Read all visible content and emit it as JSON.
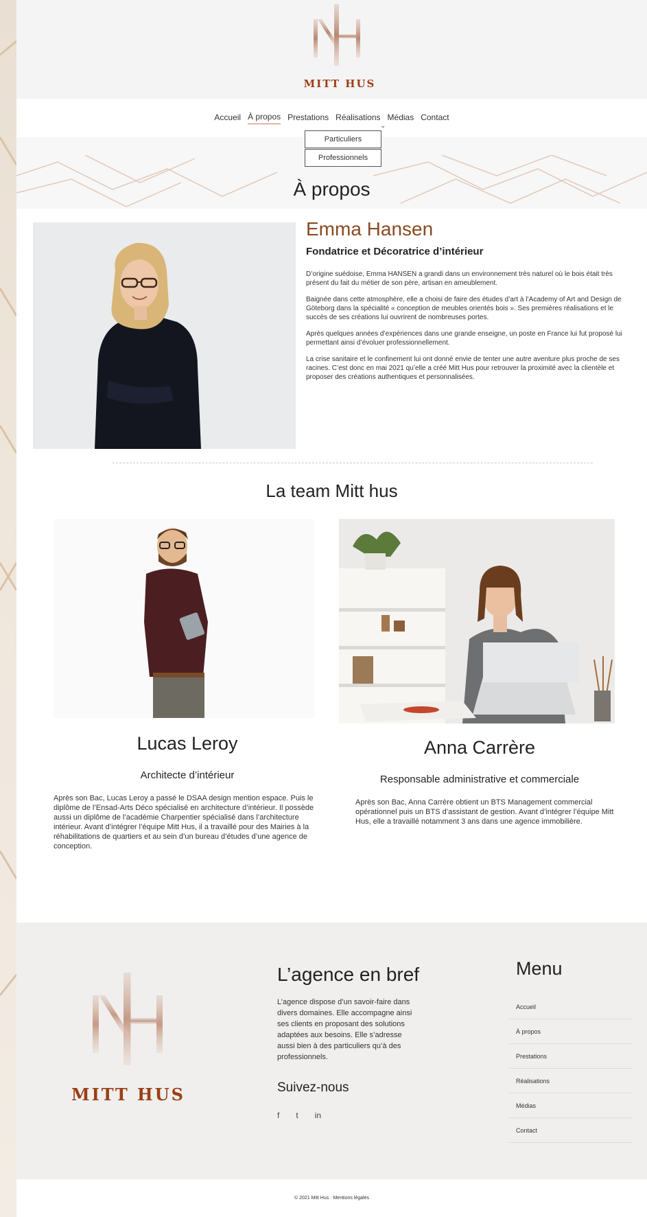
{
  "brand": {
    "name": "MITT HUS",
    "monogram": "MH",
    "accent": "#9a3f14"
  },
  "nav": {
    "items": [
      {
        "label": "Accueil"
      },
      {
        "label": "À propos",
        "active": true
      },
      {
        "label": "Prestations"
      },
      {
        "label": "Réalisations"
      },
      {
        "label": "Médias"
      },
      {
        "label": "Contact"
      }
    ],
    "dropdown": [
      "Particuliers",
      "Professionnels"
    ]
  },
  "hero": {
    "title": "À propos"
  },
  "founder": {
    "name": "Emma Hansen",
    "role": "Fondatrice et Décoratrice d’intérieur",
    "paragraphs": [
      "D’origine suédoise, Emma HANSEN a grandi dans un environnement très naturel où le bois était très présent du fait du métier de son père, artisan en ameublement.",
      "Baignée dans cette atmosphère, elle a choisi de faire des études d’art à l’Academy of Art and Design de Göteborg dans la spécialité « conception de meubles orientés bois ». Ses premières réalisations et le succès de ses créations lui ouvrirent de nombreuses portes.",
      "Après quelques années d’expériences dans une grande enseigne, un poste en France lui fut proposé lui permettant ainsi d’évoluer professionnellement.",
      "La crise sanitaire et le confinement lui ont donné envie de tenter une autre aventure plus proche de ses racines. C’est donc en mai 2021 qu’elle a créé Mitt Hus pour retrouver la proximité avec la clientèle et proposer des créations authentiques et personnalisées."
    ]
  },
  "team": {
    "title": "La team Mitt hus",
    "members": [
      {
        "name": "Lucas Leroy",
        "role": "Architecte d’intérieur",
        "bio": "Après son Bac, Lucas Leroy a passé le DSAA design mention espace. Puis le diplôme de l’Ensad-Arts Déco spécialisé en architecture d’intérieur. Il possède aussi un diplôme de l’académie Charpentier spécialisé dans l’architecture intérieur. Avant d’intégrer l’équipe Mitt Hus, il a travaillé pour des Mairies à la réhabilitations de quartiers et au sein d’un bureau d’études d’une agence de conception."
      },
      {
        "name": "Anna Carrère",
        "role": "Responsable administrative et commerciale",
        "bio": "Après son Bac, Anna Carrère obtient un BTS Management commercial opérationnel puis un BTS d’assistant de gestion. Avant d’intégrer l’équipe Mitt Hus, elle a travaillé notamment 3 ans dans une agence immobilière."
      }
    ]
  },
  "footer": {
    "agence_title": "L’agence en bref",
    "agence_text": "L’agence dispose d’un savoir-faire dans divers domaines. Elle accompagne ainsi ses clients en proposant des solutions adaptées aux besoins. Elle s’adresse aussi bien à des particuliers qu’à des professionnels.",
    "follow_title": "Suivez-nous",
    "social": [
      "f",
      "t",
      "in"
    ],
    "menu_title": "Menu",
    "menu": [
      "Accueil",
      "À propos",
      "Prestations",
      "Réalisations",
      "Médias",
      "Contact"
    ],
    "copyright": "© 2021 Mitt Hus · Mentions légales"
  }
}
